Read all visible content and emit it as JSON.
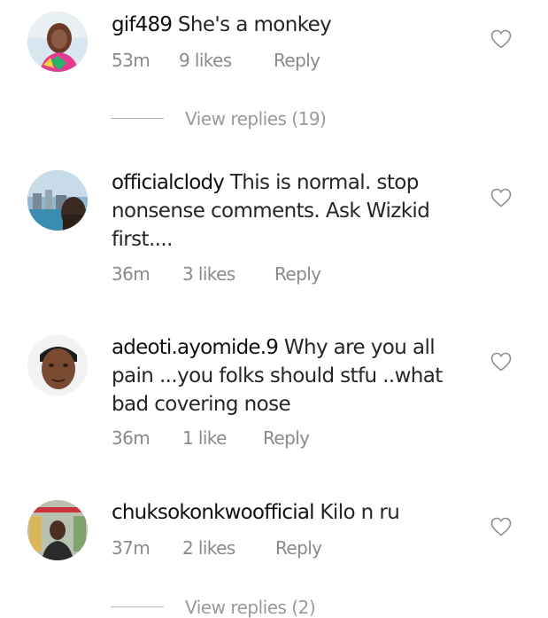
{
  "comments": [
    {
      "username": "gif489",
      "text": "She's a monkey",
      "time": "53m",
      "likes": "9 likes",
      "reply": "Reply",
      "view_replies": "View replies (19)"
    },
    {
      "username": "officialclody",
      "text": "This is normal. stop nonsense comments. Ask Wizkid first....",
      "time": "36m",
      "likes": "3 likes",
      "reply": "Reply"
    },
    {
      "username": "adeoti.ayomide.9",
      "text": "Why are you all pain ...you folks should stfu ..what bad covering nose",
      "time": "36m",
      "likes": "1 like",
      "reply": "Reply"
    },
    {
      "username": "chuksokonkwoofficial",
      "text": "Kilo n ru",
      "time": "37m",
      "likes": "2 likes",
      "reply": "Reply",
      "view_replies": "View replies (2)"
    }
  ],
  "icons": {
    "like": "heart-outline-icon"
  },
  "colors": {
    "text": "#262626",
    "meta": "#8a8a8a"
  }
}
